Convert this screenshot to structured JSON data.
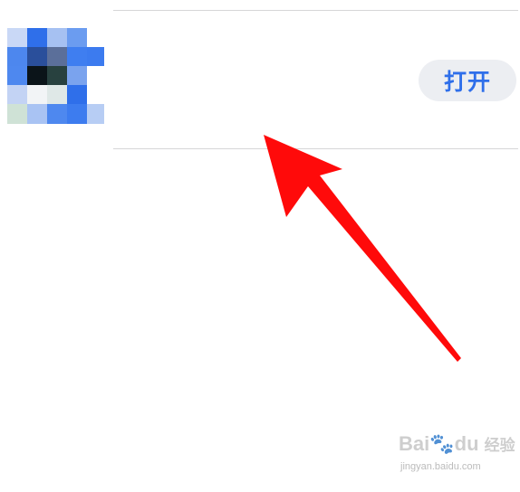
{
  "app_row": {
    "icon": "pixelated-app-icon",
    "open_button_label": "打开"
  },
  "annotation": {
    "type": "red-arrow",
    "color": "#ff0a0a"
  },
  "watermark": {
    "brand_latin": "Bai",
    "brand_mid": "du",
    "brand_cn": "经验",
    "url": "jingyan.baidu.com"
  },
  "colors": {
    "accent": "#2f6fea",
    "button_bg": "#eceef2",
    "divider": "#d6d6d8"
  }
}
